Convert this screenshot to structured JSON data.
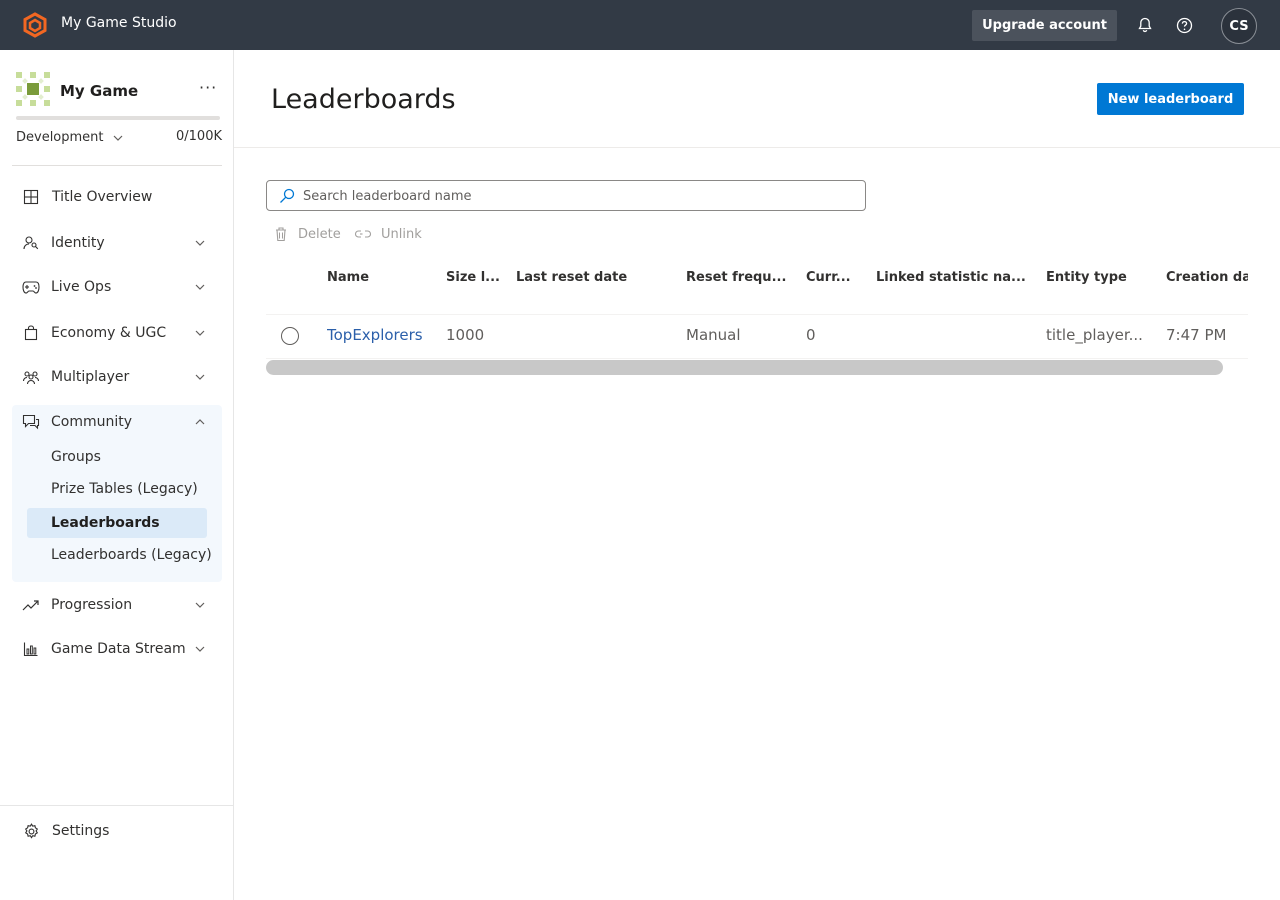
{
  "topbar": {
    "studio_name": "My Game Studio",
    "upgrade_label": "Upgrade account",
    "avatar_initials": "CS"
  },
  "sidebar": {
    "game_name": "My Game",
    "more_glyph": "···",
    "environment": "Development",
    "usage": "0/100K",
    "items": [
      {
        "label": "Title Overview",
        "icon": "grid-icon"
      },
      {
        "label": "Identity",
        "icon": "person-key-icon"
      },
      {
        "label": "Live Ops",
        "icon": "gamepad-icon"
      },
      {
        "label": "Economy & UGC",
        "icon": "shopping-bag-icon"
      },
      {
        "label": "Multiplayer",
        "icon": "people-icon"
      },
      {
        "label": "Community",
        "icon": "chat-icon",
        "expanded": true
      },
      {
        "label": "Progression",
        "icon": "trend-icon"
      },
      {
        "label": "Game Data Stream",
        "icon": "bar-chart-icon"
      }
    ],
    "community_subitems": [
      {
        "label": "Groups"
      },
      {
        "label": "Prize Tables (Legacy)"
      },
      {
        "label": "Leaderboards",
        "active": true
      },
      {
        "label": "Leaderboards (Legacy)"
      }
    ],
    "settings_label": "Settings"
  },
  "main": {
    "title": "Leaderboards",
    "new_button": "New leaderboard",
    "search_placeholder": "Search leaderboard name",
    "commands": {
      "delete": "Delete",
      "unlink": "Unlink"
    },
    "table": {
      "columns": [
        "Name",
        "Size l...",
        "Last reset date",
        "Reset frequ...",
        "Curr...",
        "Linked statistic na...",
        "Entity type",
        "Creation da"
      ],
      "rows": [
        {
          "name": "TopExplorers",
          "size": "1000",
          "last_reset": "",
          "reset_frequency": "Manual",
          "current": "0",
          "linked_statistic": "",
          "entity_type": "title_player...",
          "creation": "7:47 PM"
        }
      ]
    }
  },
  "colors": {
    "topbar_bg": "#323a45",
    "primary": "#0078d4",
    "link": "#2b5faa",
    "brand_orange": "#f26722"
  }
}
